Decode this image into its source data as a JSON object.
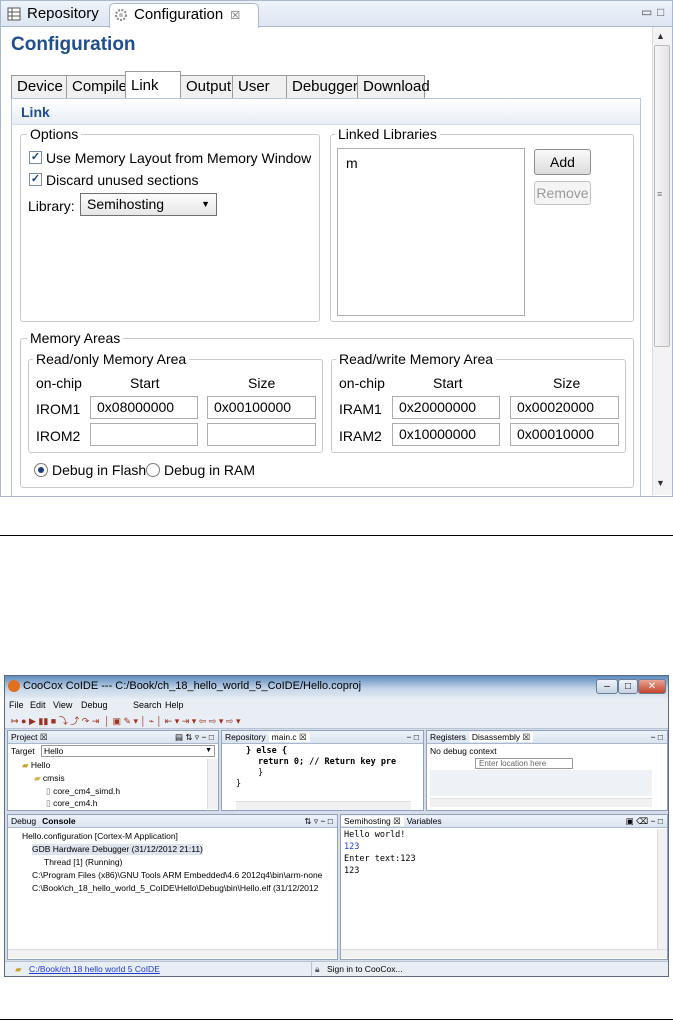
{
  "top": {
    "tabs": [
      {
        "label": "Repository",
        "icon": "repository-icon"
      },
      {
        "label": "Configuration",
        "icon": "gear-icon",
        "close": "☒"
      }
    ],
    "title": "Configuration",
    "config_tabs": [
      "Device",
      "Compile",
      "Link",
      "Output",
      "User",
      "Debugger",
      "Download"
    ],
    "section_title": "Link",
    "options": {
      "legend": "Options",
      "use_memory_layout": "Use Memory Layout from Memory Window",
      "discard_unused": "Discard unused sections",
      "library_label": "Library:",
      "library_value": "Semihosting"
    },
    "linked_libraries": {
      "legend": "Linked Libraries",
      "items": [
        "m"
      ],
      "add": "Add",
      "remove": "Remove"
    },
    "memory": {
      "legend": "Memory Areas",
      "readonly": {
        "legend": "Read/only Memory Area",
        "headers": [
          "on-chip",
          "Start",
          "Size"
        ],
        "rows": [
          {
            "name": "IROM1",
            "start": "0x08000000",
            "size": "0x00100000"
          },
          {
            "name": "IROM2",
            "start": "",
            "size": ""
          }
        ]
      },
      "readwrite": {
        "legend": "Read/write Memory Area",
        "headers": [
          "on-chip",
          "Start",
          "Size"
        ],
        "rows": [
          {
            "name": "IRAM1",
            "start": "0x20000000",
            "size": "0x00020000"
          },
          {
            "name": "IRAM2",
            "start": "0x10000000",
            "size": "0x00010000"
          }
        ]
      },
      "debug_flash": "Debug in Flash",
      "debug_ram": "Debug in RAM"
    }
  },
  "ide": {
    "title": "CooCox CoIDE --- C:/Book/ch_18_hello_world_5_CoIDE/Hello.coproj",
    "menu": [
      "File",
      "Edit",
      "View",
      "Debug",
      "Search",
      "Help"
    ],
    "project": {
      "tab": "Project ☒",
      "target_label": "Target",
      "target_value": "Hello",
      "tree": [
        "Hello",
        "cmsis",
        "core_cm4_simd.h",
        "core_cm4.h"
      ]
    },
    "editor": {
      "tabs": [
        "Repository",
        "main.c ☒"
      ],
      "lines": [
        "} else {",
        "return 0; // Return key pre",
        "}",
        "}"
      ]
    },
    "disasm": {
      "tabs": [
        "Registers",
        "Disassembly ☒"
      ],
      "context": "No debug context",
      "location_placeholder": "Enter location here"
    },
    "debug": {
      "tabs": [
        "Debug",
        "Console"
      ],
      "lines": [
        "Hello.configuration [Cortex-M Application]",
        "GDB Hardware Debugger (31/12/2012 21:11)",
        "Thread [1] (Running)",
        "C:\\Program Files (x86)\\GNU Tools ARM Embedded\\4.6 2012q4\\bin\\arm-none",
        "C:\\Book\\ch_18_hello_world_5_CoIDE\\Hello\\Debug\\bin\\Hello.elf (31/12/2012"
      ]
    },
    "semihosting": {
      "tabs": [
        "Semihosting ☒",
        "Variables"
      ],
      "lines": [
        "Hello world!",
        "123",
        "Enter text:123",
        "123"
      ]
    },
    "status": {
      "path": "C:/Book/ch 18 hello world 5 CoIDE",
      "signin": "Sign in to CooCox..."
    }
  }
}
